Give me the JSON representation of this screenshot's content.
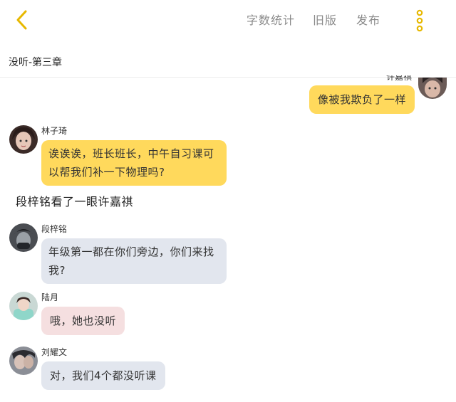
{
  "header": {
    "back_icon": "chevron-left-icon",
    "word_count_label": "字数统计",
    "old_version_label": "旧版",
    "publish_label": "发布",
    "more_icon": "vertical-dots-icon",
    "accent_color": "#e7b800"
  },
  "chapter": {
    "title": "没听-第三章"
  },
  "messages": [
    {
      "speaker": "许嘉祺",
      "text": "像被我欺负了一样",
      "side": "right",
      "color": "#ffd95c"
    },
    {
      "speaker": "林子琦",
      "text": "诶诶诶，班长班长，中午自习课可以帮我们补一下物理吗?",
      "side": "left",
      "color": "#ffd95c"
    },
    {
      "narration": "段梓铭看了一眼许嘉祺"
    },
    {
      "speaker": "段梓铭",
      "text": "年级第一都在你们旁边，你们来找我?",
      "side": "left",
      "color": "#e2e6ee"
    },
    {
      "speaker": "陆月",
      "text": "哦，她也没听",
      "side": "left",
      "color": "#f5dfe0"
    },
    {
      "speaker": "刘耀文",
      "text": "对，我们4个都没听课",
      "side": "left",
      "color": "#e2e6ee"
    }
  ]
}
